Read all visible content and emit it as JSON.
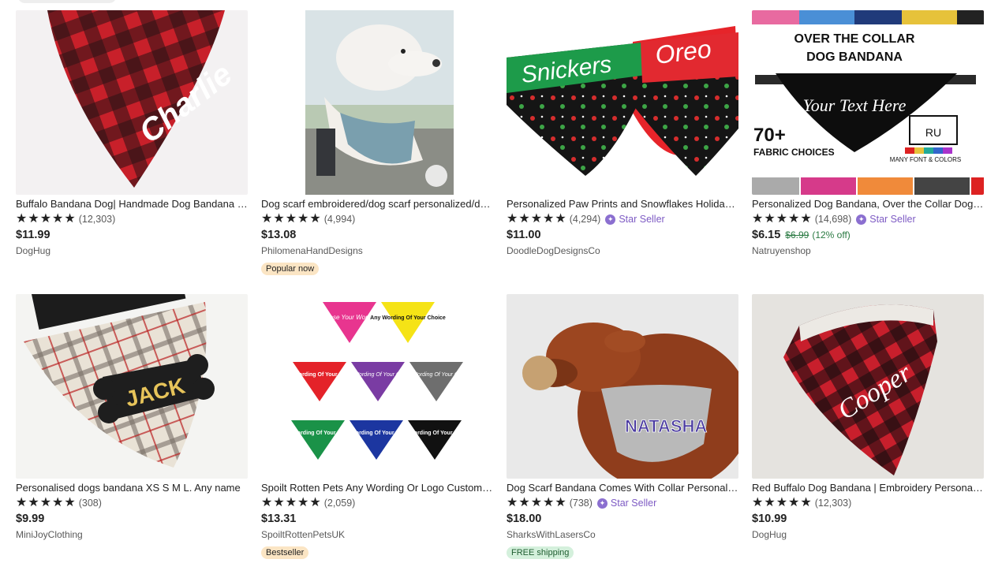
{
  "listings": [
    {
      "title": "Buffalo Bandana Dog| Handmade Dog Bandana | Personalised",
      "rating_count": "(12,303)",
      "star_seller": "",
      "price": "$11.99",
      "old_price": "",
      "discount": "",
      "shop": "DogHug",
      "badge": "",
      "thumb_text": "Charlie",
      "icon": "buffalo-plaid-bandana-image"
    },
    {
      "title": "Dog scarf embroidered/dog scarf personalized/dog bandana",
      "rating_count": "(4,994)",
      "star_seller": "",
      "price": "$13.08",
      "old_price": "",
      "discount": "",
      "shop": "PhilomenaHandDesigns",
      "badge": "Popular now",
      "thumb_text": "",
      "icon": "white-dog-scarf-image"
    },
    {
      "title": "Personalized Paw Prints and Snowflakes Holiday Dog Bandana",
      "rating_count": "(4,294)",
      "star_seller": "Star Seller",
      "price": "$11.00",
      "old_price": "",
      "discount": "",
      "shop": "DoodleDogDesignsCo",
      "badge": "",
      "thumb_text": "Snickers",
      "thumb_text2": "Oreo",
      "icon": "paw-print-bandanas-image"
    },
    {
      "title": "Personalized Dog Bandana, Over the Collar Dog Bandana",
      "rating_count": "(14,698)",
      "star_seller": "Star Seller",
      "price": "$6.15",
      "old_price": "$6.99",
      "discount": "(12% off)",
      "shop": "Natruyenshop",
      "badge": "",
      "thumb_text": "OVER THE COLLAR",
      "thumb_text2": "DOG  BANDANA",
      "thumb_text3": "Your Text Here",
      "thumb_text4": "70+",
      "thumb_text5": "FABRIC CHOICES",
      "thumb_text6": "MANY FONT & COLORS",
      "thumb_text7": "RU",
      "icon": "over-collar-bandana-image"
    },
    {
      "title": "Personalised dogs bandana XS S M L. Any name",
      "rating_count": "(308)",
      "star_seller": "",
      "price": "$9.99",
      "old_price": "",
      "discount": "",
      "shop": "MiniJoyClothing",
      "badge": "",
      "thumb_text": "JACK",
      "icon": "tartan-bandana-image"
    },
    {
      "title": "Spoilt Rotten Pets Any Wording Or Logo Custom Dog Bandana",
      "rating_count": "(2,059)",
      "star_seller": "",
      "price": "$13.31",
      "old_price": "",
      "discount": "",
      "shop": "SpoiltRottenPetsUK",
      "badge": "Bestseller",
      "thumb_text": "Choose Your Wording!",
      "thumb_text2": "Any Wording Of Your Choice",
      "icon": "wording-bandanas-image"
    },
    {
      "title": "Dog Scarf Bandana Comes With Collar Personalised",
      "rating_count": "(738)",
      "star_seller": "Star Seller",
      "price": "$18.00",
      "old_price": "",
      "discount": "",
      "shop": "SharksWithLasersCo",
      "badge": "FREE shipping",
      "thumb_text": "NATASHA",
      "icon": "spaniel-bandana-image"
    },
    {
      "title": "Red Buffalo Dog Bandana | Embroidery Personalized",
      "rating_count": "(12,303)",
      "star_seller": "",
      "price": "$10.99",
      "old_price": "",
      "discount": "",
      "shop": "DogHug",
      "badge": "",
      "thumb_text": "Cooper",
      "icon": "red-buffalo-bandana-image"
    }
  ],
  "star_glyph": "★"
}
